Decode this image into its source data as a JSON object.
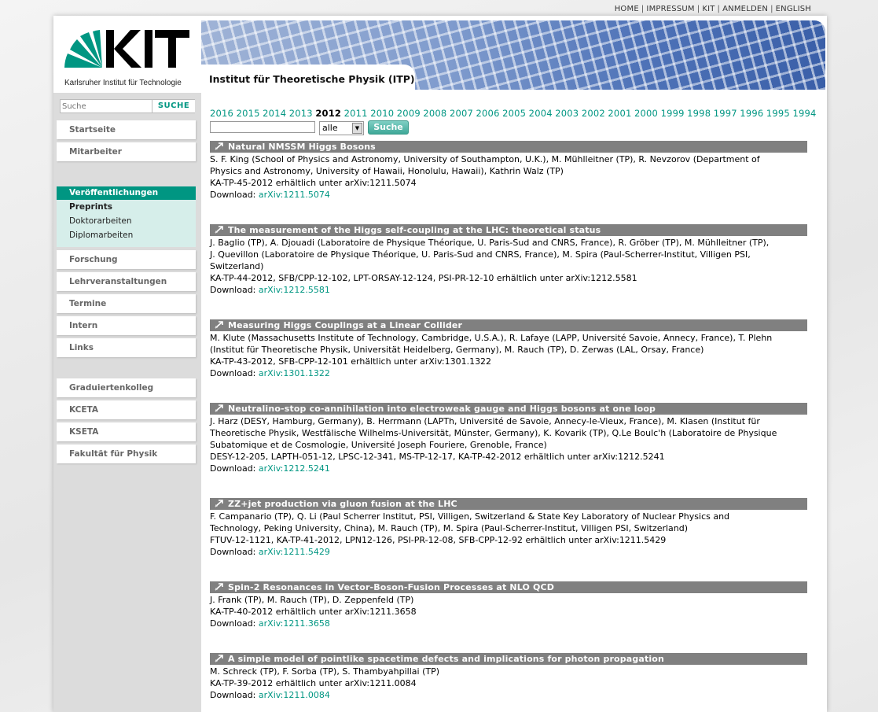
{
  "topnav": {
    "home": "HOME",
    "impressum": "IMPRESSUM",
    "kit": "KIT",
    "anmelden": "ANMELDEN",
    "english": "ENGLISH"
  },
  "header": {
    "logo_sub": "Karlsruher Institut für Technologie",
    "institute": "Institut für Theoretische Physik (ITP)"
  },
  "search": {
    "placeholder": "Suche",
    "button": "SUCHE"
  },
  "sidebar": {
    "items": [
      "Startseite",
      "Mitarbeiter"
    ],
    "active": "Veröffentlichungen",
    "sub": [
      "Preprints",
      "Doktorarbeiten",
      "Diplomarbeiten"
    ],
    "items2": [
      "Forschung",
      "Lehrveranstaltungen",
      "Termine",
      "Intern",
      "Links"
    ],
    "items3": [
      "Graduiertenkolleg",
      "KCETA",
      "KSETA",
      "Fakultät für Physik"
    ]
  },
  "years": [
    "2016",
    "2015",
    "2014",
    "2013",
    "2012",
    "2011",
    "2010",
    "2009",
    "2008",
    "2007",
    "2006",
    "2005",
    "2004",
    "2003",
    "2002",
    "2001",
    "2000",
    "1999",
    "1998",
    "1997",
    "1996",
    "1995",
    "1994"
  ],
  "current_year": "2012",
  "filter": {
    "select_value": "alle",
    "button": "Suche"
  },
  "download_label": "Download: ",
  "publications": [
    {
      "title": "Natural NMSSM Higgs Bosons",
      "lines": [
        "S. F. King (School of Physics and Astronomy, University of Southampton, U.K.), M. Mühlleitner (TP), R. Nevzorov (Department of",
        "Physics and Astronomy, University of Hawaii, Honolulu, Hawaii), Kathrin Walz (TP)",
        "KA-TP-45-2012 erhältlich unter arXiv:1211.5074"
      ],
      "link": "arXiv:1211.5074"
    },
    {
      "title": "The measurement of the Higgs self-coupling at the LHC: theoretical status",
      "lines": [
        "J. Baglio (TP), A. Djouadi (Laboratoire de Physique Théorique, U. Paris-Sud and CNRS, France), R. Gröber (TP), M. Mühlleitner (TP),",
        "J. Quevillon (Laboratoire de Physique Théorique, U. Paris-Sud and CNRS, France), M. Spira (Paul-Scherrer-Institut, Villigen PSI,",
        "Switzerland)",
        "KA-TP-44-2012, SFB/CPP-12-102, LPT-ORSAY-12-124, PSI-PR-12-10 erhältlich unter arXiv:1212.5581"
      ],
      "link": "arXiv:1212.5581"
    },
    {
      "title": "Measuring Higgs Couplings at a Linear Collider",
      "lines": [
        "M. Klute (Massachusetts Institute of Technology, Cambridge, U.S.A.), R. Lafaye (LAPP, Université Savoie, Annecy, France), T. Plehn",
        "(Institut für Theoretische Physik, Universität Heidelberg, Germany), M. Rauch (TP), D. Zerwas (LAL, Orsay, France)",
        "KA-TP-43-2012, SFB-CPP-12-101 erhältlich unter arXiv:1301.1322"
      ],
      "link": "arXiv:1301.1322"
    },
    {
      "title": "Neutralino-stop co-annihilation into electroweak gauge and Higgs bosons at one loop",
      "lines": [
        "J. Harz (DESY, Hamburg, Germany), B. Herrmann (LAPTh, Université de Savoie, Annecy-le-Vieux, France), M. Klasen (Institut für",
        "Theoretische Physik, Westfälische Wilhelms-Universität, Münster, Germany), K. Kovarik (TP), Q.Le Boulc'h (Laboratoire de Physique",
        "Subatomique et de Cosmologie, Université Joseph Fouriere, Grenoble, France)",
        "DESY-12-205, LAPTH-051-12, LPSC-12-341, MS-TP-12-17, KA-TP-42-2012 erhältlich unter arXiv:1212.5241"
      ],
      "link": "arXiv:1212.5241"
    },
    {
      "title": "ZZ+jet production via gluon fusion at the LHC",
      "lines": [
        "F. Campanario (TP), Q. Li (Paul Scherrer Institut, PSI, Villigen, Switzerland & State Key Laboratory of Nuclear Physics and",
        "Technology, Peking University, China), M. Rauch (TP), M. Spira (Paul-Scherrer-Institut, Villigen PSI, Switzerland)",
        "FTUV-12-1121, KA-TP-41-2012, LPN12-126, PSI-PR-12-08, SFB-CPP-12-92 erhältlich unter arXiv:1211.5429"
      ],
      "link": "arXiv:1211.5429"
    },
    {
      "title": "Spin-2 Resonances in Vector-Boson-Fusion Processes at NLO QCD",
      "lines": [
        "J. Frank (TP), M. Rauch (TP), D. Zeppenfeld (TP)",
        "KA-TP-40-2012 erhältlich unter arXiv:1211.3658"
      ],
      "link": "arXiv:1211.3658"
    },
    {
      "title": "A simple model of pointlike spacetime defects and implications for photon propagation",
      "lines": [
        "M. Schreck (TP), F. Sorba (TP), S. Thambyahpillai (TP)",
        "KA-TP-39-2012 erhältlich unter arXiv:1211.0084"
      ],
      "link": "arXiv:1211.0084"
    }
  ]
}
